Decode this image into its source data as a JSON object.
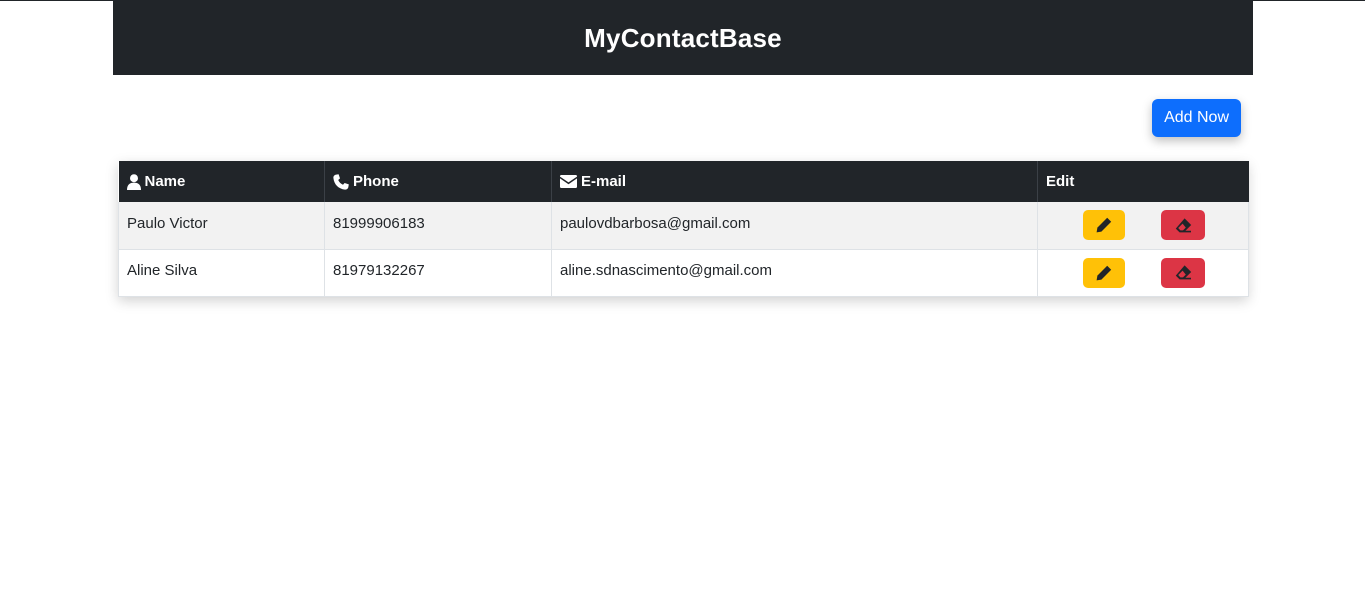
{
  "header": {
    "title": "MyContactBase"
  },
  "toolbar": {
    "add_label": "Add Now"
  },
  "table": {
    "columns": [
      {
        "label": "Name",
        "icon": "user-icon"
      },
      {
        "label": "Phone",
        "icon": "phone-icon"
      },
      {
        "label": "E-mail",
        "icon": "envelope-icon"
      },
      {
        "label": "Edit",
        "icon": ""
      }
    ],
    "rows": [
      {
        "name": "Paulo Victor",
        "phone": "81999906183",
        "email": "paulovdbarbosa@gmail.com"
      },
      {
        "name": "Aline Silva",
        "phone": "81979132267",
        "email": "aline.sdnascimento@gmail.com"
      }
    ]
  },
  "colors": {
    "header_bg": "#212529",
    "primary": "#0d6efd",
    "warning": "#ffc107",
    "danger": "#dc3545"
  }
}
